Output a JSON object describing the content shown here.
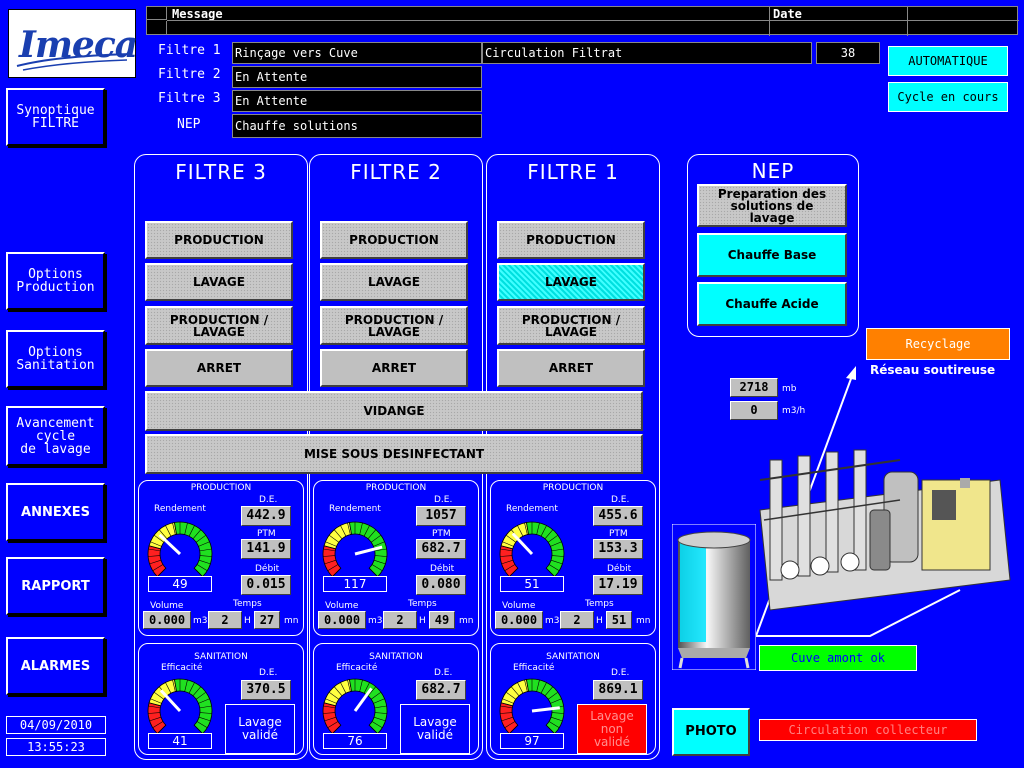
{
  "logo": "Imeca",
  "header": {
    "message_label": "Message",
    "date_label": "Date"
  },
  "status_rows": [
    {
      "label": "Filtre 1",
      "value": "Rinçage vers Cuve"
    },
    {
      "label": "Filtre 2",
      "value": "En Attente"
    },
    {
      "label": "Filtre 3",
      "value": "En Attente"
    },
    {
      "label": "NEP",
      "value": "Chauffe solutions"
    }
  ],
  "circulation": {
    "text": "Circulation Filtrat",
    "count": "38"
  },
  "mode": {
    "auto": "AUTOMATIQUE",
    "cycle": "Cycle en cours"
  },
  "nav": {
    "synoptique": "Synoptique\nFILTRE",
    "options_production": "Options\nProduction",
    "options_sanitation": "Options\nSanitation",
    "avancement": "Avancement\ncycle\nde lavage",
    "annexes": "ANNEXES",
    "rapport": "RAPPORT",
    "alarmes": "ALARMES"
  },
  "datetime": {
    "date": "04/09/2010",
    "time": "13:55:23"
  },
  "buttons": {
    "production": "PRODUCTION",
    "lavage": "LAVAGE",
    "production_lavage": "PRODUCTION /\nLAVAGE",
    "arret": "ARRET",
    "vidange": "VIDANGE",
    "mise": "MISE SOUS DESINFECTANT"
  },
  "labels": {
    "production": "PRODUCTION",
    "sanitation": "SANITATION",
    "rendement": "Rendement",
    "efficacite": "Efficacité",
    "de": "D.E.",
    "ptm": "PTM",
    "debit": "Débit",
    "volume": "Volume",
    "temps": "Temps",
    "m3": "m3",
    "h": "H",
    "mn": "mn"
  },
  "filtres": [
    {
      "title": "FILTRE 3",
      "lavage_active": false,
      "prod": {
        "rendement": 49,
        "de": "442.9",
        "ptm": "141.9",
        "debit": "0.015",
        "volume": "0.000",
        "hours": "2",
        "minutes": "27"
      },
      "sani": {
        "efficacite": 41,
        "de": "370.5",
        "status": "Lavage\nvalidé",
        "status_ok": true
      }
    },
    {
      "title": "FILTRE 2",
      "lavage_active": false,
      "prod": {
        "rendement": 117,
        "de": "1057",
        "ptm": "682.7",
        "debit": "0.080",
        "volume": "0.000",
        "hours": "2",
        "minutes": "49"
      },
      "sani": {
        "efficacite": 76,
        "de": "682.7",
        "status": "Lavage\nvalidé",
        "status_ok": true
      }
    },
    {
      "title": "FILTRE 1",
      "lavage_active": true,
      "prod": {
        "rendement": 51,
        "de": "455.6",
        "ptm": "153.3",
        "debit": "17.19",
        "volume": "0.000",
        "hours": "2",
        "minutes": "51"
      },
      "sani": {
        "efficacite": 97,
        "de": "869.1",
        "status": "Lavage\nnon\nvalidé",
        "status_ok": false
      }
    }
  ],
  "nep": {
    "title": "NEP",
    "prep": "Preparation des\nsolutions de\nlavage",
    "chauffe_base": "Chauffe Base",
    "chauffe_acide": "Chauffe Acide"
  },
  "recyclage": {
    "label": "Recyclage",
    "reseau": "Réseau soutireuse"
  },
  "readings": {
    "pressure": "2718",
    "pressure_unit": "mb",
    "flow": "0",
    "flow_unit": "m3/h"
  },
  "cuve_status": "Cuve amont ok",
  "photo": "PHOTO",
  "circulation_collecteur": "Circulation collecteur",
  "colors": {
    "background": "#0000ff",
    "cyan": "#00ffff",
    "orange": "#ff8000",
    "green": "#00ff00",
    "red": "#ff0000",
    "gray": "#c0c0c0"
  }
}
